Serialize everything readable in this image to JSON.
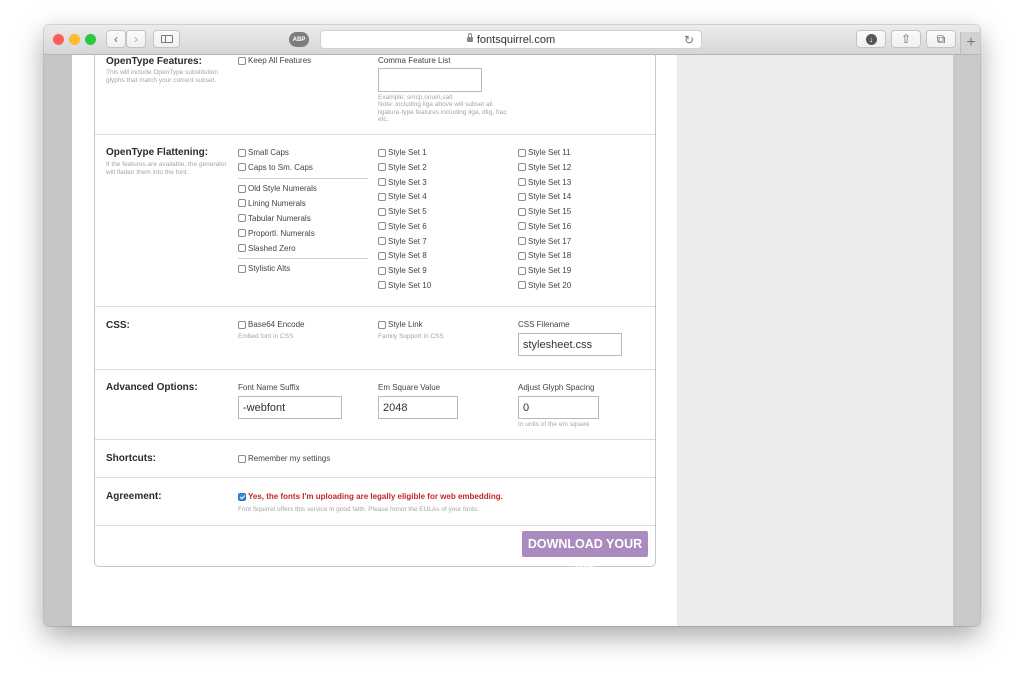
{
  "browser": {
    "url": "fontsquirrel.com",
    "abp_label": "ABP",
    "icons": [
      "back-icon",
      "forward-icon",
      "sidebar-icon",
      "reload-icon",
      "download-icon",
      "share-icon",
      "tabs-icon",
      "new-tab-icon"
    ]
  },
  "opentype_features": {
    "label": "OpenType Features:",
    "desc": "This will include OpenType substitution glyphs that match your current subset.",
    "keep_all": "Keep All Features",
    "comma_list_label": "Comma Feature List",
    "comma_list_value": "",
    "example": "Example: smcp,onum,salt",
    "note": "Note: including liga above will subset all ligature-type features including liga, dlig, frac etc."
  },
  "flattening": {
    "label": "OpenType Flattening:",
    "desc": "If the features are available, the generator will flatten them into the font.",
    "col1_group1": [
      "Small Caps",
      "Caps to Sm. Caps"
    ],
    "col1_group2": [
      "Old Style Numerals",
      "Lining Numerals",
      "Tabular Numerals",
      "Proportl. Numerals",
      "Slashed Zero"
    ],
    "col1_group3": [
      "Stylistic Alts"
    ],
    "style_sets_a": [
      "Style Set 1",
      "Style Set 2",
      "Style Set 3",
      "Style Set 4",
      "Style Set 5",
      "Style Set 6",
      "Style Set 7",
      "Style Set 8",
      "Style Set 9",
      "Style Set 10"
    ],
    "style_sets_b": [
      "Style Set 11",
      "Style Set 12",
      "Style Set 13",
      "Style Set 14",
      "Style Set 15",
      "Style Set 16",
      "Style Set 17",
      "Style Set 18",
      "Style Set 19",
      "Style Set 20"
    ]
  },
  "css": {
    "label": "CSS:",
    "base64": "Base64 Encode",
    "base64_hint": "Embed font in CSS",
    "style_link": "Style Link",
    "style_link_hint": "Family Support in CSS",
    "filename_label": "CSS Filename",
    "filename_value": "stylesheet.css"
  },
  "advanced": {
    "label": "Advanced Options:",
    "suffix_label": "Font Name Suffix",
    "suffix_value": "-webfont",
    "em_label": "Em Square Value",
    "em_value": "2048",
    "spacing_label": "Adjust Glyph Spacing",
    "spacing_value": "0",
    "spacing_hint": "In units of the em square"
  },
  "shortcuts": {
    "label": "Shortcuts:",
    "remember": "Remember my settings"
  },
  "agreement": {
    "label": "Agreement:",
    "checked": true,
    "text": "Yes, the fonts I'm uploading are legally eligible for web embedding.",
    "hint": "Font Squirrel offers this service in good faith. Please honor the EULAs of your fonts."
  },
  "download_button": "DOWNLOAD YOUR KIT",
  "colors": {
    "agreement_text": "#c1272d",
    "download_button": "#a98bbd",
    "checkbox_checked": "#3b87d8"
  }
}
